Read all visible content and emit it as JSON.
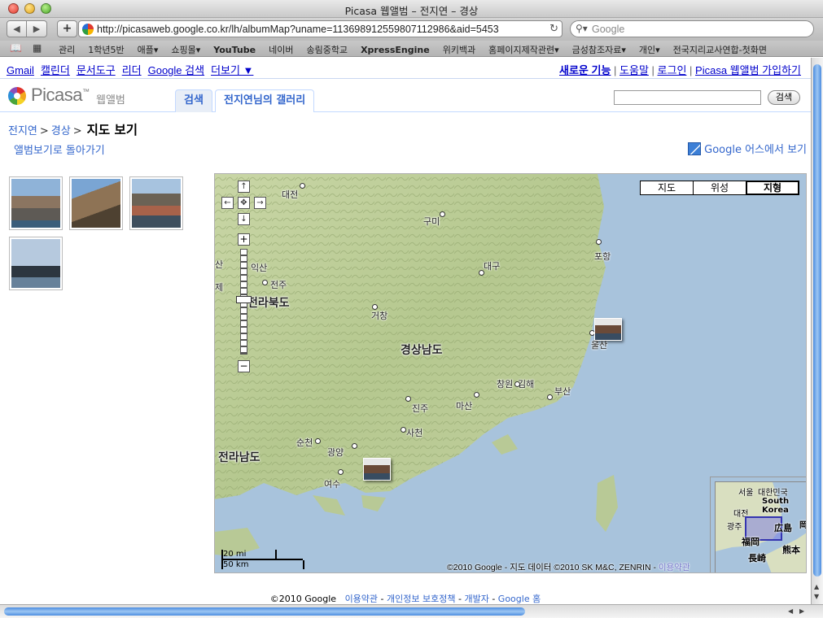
{
  "window": {
    "title": "Picasa 웹앨범 – 전지연 – 경상"
  },
  "toolbar": {
    "back": "◀",
    "forward": "▶",
    "add": "+",
    "url": "http://picasaweb.google.co.kr/lh/albumMap?uname=113698912559807112986&aid=5453",
    "reload": "↻",
    "search_placeholder": "Google"
  },
  "bookmarks": [
    "관리",
    "1학년5반",
    "애플▾",
    "쇼핑몰▾",
    "YouTube",
    "네이버",
    "송림중학교",
    "XpressEngine",
    "위키백과",
    "홈페이지제작관련▾",
    "금성참조자료▾",
    "개인▾",
    "전국지리교사연합-첫화면"
  ],
  "gbar": {
    "left": [
      "Gmail",
      "캘린더",
      "문서도구",
      "리더",
      "Google 검색",
      "더보기 ▼"
    ],
    "new_features": "새로운 기능",
    "help": "도움말",
    "login": "로그인",
    "signup": "Picasa 웹앨범 가입하기"
  },
  "header": {
    "logo_word": "Picasa",
    "logo_tm": "™",
    "logo_sub": "웹앨범",
    "tab_search": "검색",
    "tab_gallery": "전지연님의 갤러리",
    "search_button": "검색"
  },
  "breadcrumb": {
    "user": "전지연",
    "album": "경상",
    "sep": ">",
    "title": "지도 보기"
  },
  "back_to_album": "앨범보기로 돌아가기",
  "earth_link": "Google 어스에서 보기",
  "map": {
    "type_buttons": [
      "지도",
      "위성",
      "지형"
    ],
    "active_type": "지형",
    "labels": {
      "daejeon": "대전",
      "gumi": "구미",
      "pohang": "포항",
      "daegu": "대구",
      "jeonju": "전주",
      "jeonbuk": "전라북도",
      "geochang": "거창",
      "gyeongnam": "경상남도",
      "ulsan": "울산",
      "changwon": "창원",
      "gimhae": "김해",
      "busan": "부산",
      "jinju": "진주",
      "masan": "마산",
      "sacheon": "사천",
      "suncheon": "순천",
      "gwangyang": "광양",
      "jeonnam": "전라남도",
      "yeosu": "여수",
      "iksan": "익산",
      "gimje": "제",
      "san": "산"
    },
    "scale_top": "20 mi",
    "scale_bottom": "50 km",
    "copyright": "©2010 Google - 지도 데이터 ©2010 SK M&C, ZENRIN - ",
    "terms": "이용약관",
    "overview": {
      "seoul": "서울",
      "korea_kr": "대한민국",
      "south": "South",
      "korea": "Korea",
      "daejeon": "대전",
      "gwangju": "광주",
      "hiroshima": "広島",
      "fukuoka": "福岡",
      "nagasaki": "長崎",
      "kumamoto": "熊本",
      "other": "岡"
    }
  },
  "footer": {
    "copyright": "©2010 Google",
    "links": [
      "이용약관",
      "개인정보 보호정책",
      "개발자",
      "Google 홈"
    ],
    "sep": " - "
  }
}
